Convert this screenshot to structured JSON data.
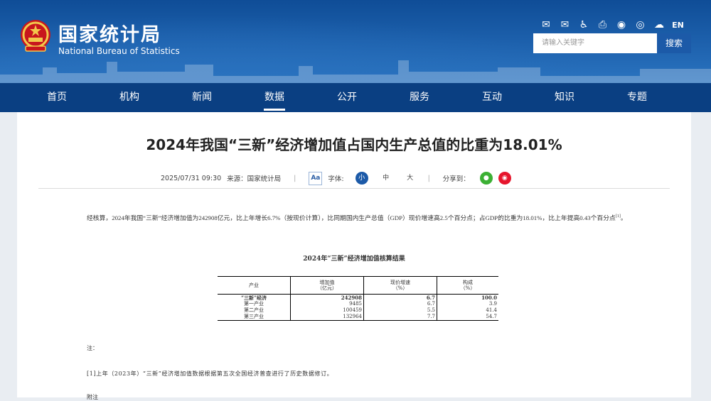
{
  "site": {
    "name_cn": "国家统计局",
    "name_en": "National Bureau of Statistics",
    "tools": [
      "mail-icon",
      "mailbox-icon",
      "accessibility-icon",
      "print-icon",
      "elder-mode-icon",
      "weibo-icon",
      "wechat-icon"
    ],
    "lang": "EN",
    "search_placeholder": "请输入关键字",
    "search_button": "搜索"
  },
  "nav": [
    "首页",
    "机构",
    "新闻",
    "数据",
    "公开",
    "服务",
    "互动",
    "知识",
    "专题"
  ],
  "article": {
    "title": "2024年我国“三新”经济增加值占国内生产总值的比重为18.01%",
    "date": "2025/07/31 09:30",
    "source": "来源：国家统计局",
    "font_label": "字体:",
    "aa": "Aa",
    "sizes": [
      "小",
      "中",
      "大"
    ],
    "share": "分享到：",
    "paragraph": "经核算，2024年我国“三新”经济增加值为242908亿元，比上年增长6.7%（按现价计算），比同期国内生产总值（GDP）现价增速高2.5个百分点；占GDP的比重为18.01%，比上年提高0.43个百分点",
    "paragraph_note": "[1]",
    "paragraph_end": "。",
    "table_caption": "2024年“三新”经济增加值核算结果",
    "table_header": [
      {
        "l1": "产业",
        "l2": ""
      },
      {
        "l1": "增加值",
        "l2": "（亿元）"
      },
      {
        "l1": "现价增速",
        "l2": "（%）"
      },
      {
        "l1": "构成",
        "l2": "（%）"
      }
    ],
    "table_rows": [
      {
        "name": "“三新”经济",
        "value": "242908",
        "growth": "6.7",
        "share": "100.0"
      },
      {
        "name": "第一产业",
        "value": "9485",
        "growth": "6.7",
        "share": "3.9"
      },
      {
        "name": "第二产业",
        "value": "100459",
        "growth": "5.5",
        "share": "41.4"
      },
      {
        "name": "第三产业",
        "value": "132964",
        "growth": "7.7",
        "share": "54.7"
      }
    ],
    "note_label": "注：",
    "note_1": "[1]上年（2023年）“三新”经济增加值数据根据第五次全国经济普查进行了历史数据修订。",
    "note_cut": "附注"
  }
}
